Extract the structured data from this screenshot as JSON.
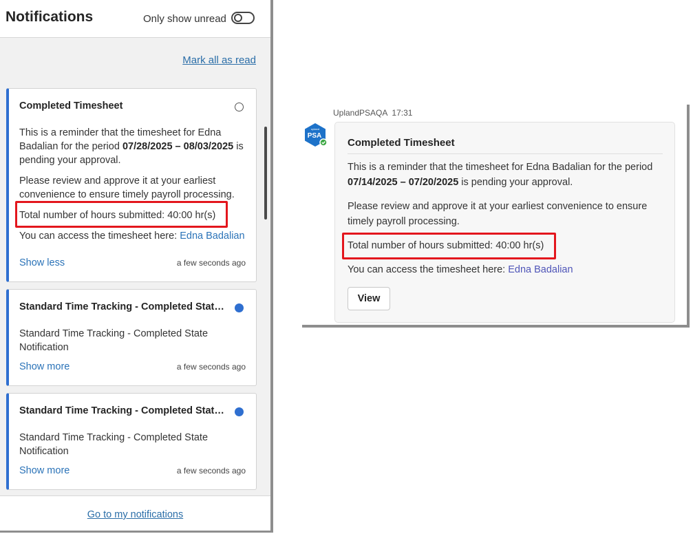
{
  "panel": {
    "title": "Notifications",
    "unread_toggle_label": "Only show unread",
    "mark_all_label": "Mark all as read",
    "footer_link": "Go to my notifications"
  },
  "cards": [
    {
      "title": "Completed Timesheet",
      "line1_pre": "This is a reminder that the timesheet for Edna Badalian for the period ",
      "line1_bold": "07/28/2025 – 08/03/2025",
      "line1_post": " is pending your approval.",
      "line2": "Please review and approve it at your earliest convenience to ensure timely payroll processing.",
      "line3": "Total number of hours submitted: 40:00 hr(s)",
      "line4_pre": "You can access the timesheet here: ",
      "line4_link": "Edna Badalian",
      "toggle_label": "Show less",
      "timestamp": "a few seconds ago"
    },
    {
      "title": "Standard Time Tracking - Completed State N...",
      "body": "Standard Time Tracking - Completed State Notification",
      "toggle_label": "Show more",
      "timestamp": "a few seconds ago"
    },
    {
      "title": "Standard Time Tracking - Completed State N...",
      "body": "Standard Time Tracking - Completed State Notification",
      "toggle_label": "Show more",
      "timestamp": "a few seconds ago"
    }
  ],
  "chat": {
    "sender": "UplandPSAQA",
    "time": "17:31",
    "avatar_small": "upland",
    "avatar_text": "PSA",
    "title": "Completed Timesheet",
    "line1_pre": "This is a reminder that the timesheet for Edna Badalian for the period ",
    "line1_bold": "07/14/2025 – 07/20/2025",
    "line1_post": " is pending your approval.",
    "line2": "Please review and approve it at your earliest convenience to ensure timely payroll processing.",
    "line3": "Total number of hours submitted: 40:00 hr(s)",
    "line4_pre": "You can access the timesheet here: ",
    "line4_link": "Edna Badalian",
    "view_label": "View"
  },
  "colors": {
    "accent": "#2f6fd0",
    "link": "#2b73b8",
    "highlight": "#e3161d",
    "avatar_bg": "#1d72c9",
    "presence": "#3fa846"
  }
}
